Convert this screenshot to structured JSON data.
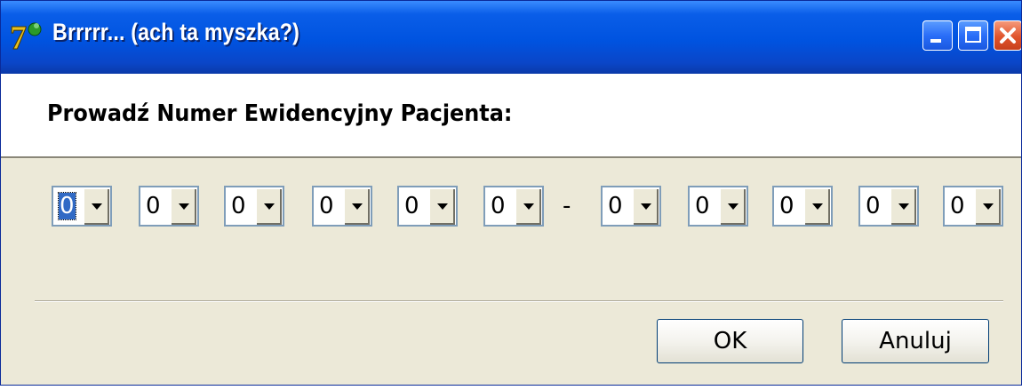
{
  "window": {
    "title": "Brrrrr... (ach ta myszka?)",
    "icons": {
      "app": "app-icon",
      "minimize": "minimize-icon",
      "maximize": "maximize-icon",
      "close": "close-icon"
    }
  },
  "prompt": "Prowadź Numer Ewidencyjny Pacjenta:",
  "digits_group1": [
    "0",
    "0",
    "0",
    "0",
    "0",
    "0"
  ],
  "separator": "-",
  "digits_group2": [
    "0",
    "0",
    "0",
    "0",
    "0"
  ],
  "buttons": {
    "ok": "OK",
    "cancel": "Anuluj"
  },
  "colors": {
    "titlebar": "#0053e0",
    "dialog_bg": "#ece9d8",
    "header_bg": "#ffffff",
    "close_button": "#e0542c"
  }
}
